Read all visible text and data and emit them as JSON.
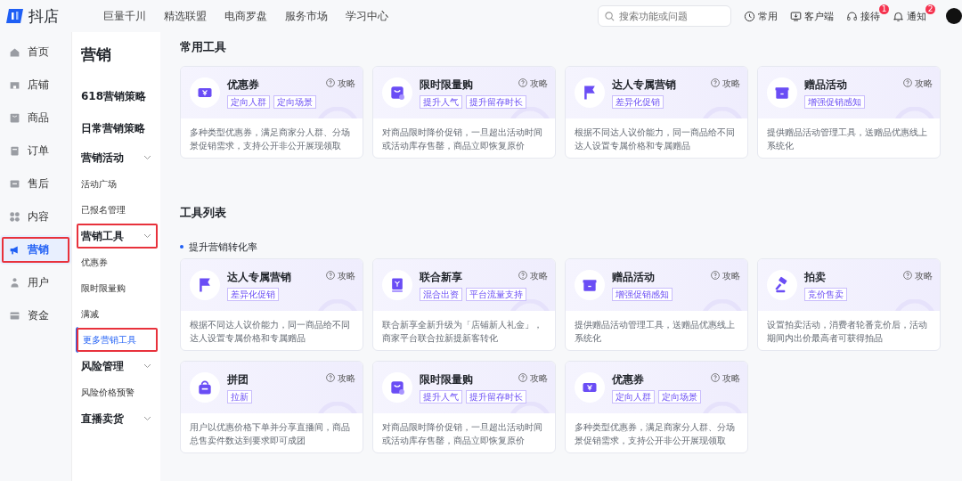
{
  "topbar": {
    "logo": "抖店",
    "nav": [
      "巨量千川",
      "精选联盟",
      "电商罗盘",
      "服务市场",
      "学习中心"
    ],
    "search": {
      "placeholder": "搜索功能或问题"
    },
    "actions": [
      {
        "kind": "clock",
        "label": "常用"
      },
      {
        "kind": "monitor",
        "label": "客户端"
      },
      {
        "kind": "headset",
        "label": "接待",
        "badge": "1"
      },
      {
        "kind": "bell",
        "label": "通知",
        "badge": "2"
      }
    ]
  },
  "nav": [
    {
      "label": "首页",
      "selected": false,
      "highlighted": false
    },
    {
      "label": "店铺",
      "selected": false,
      "highlighted": false
    },
    {
      "label": "商品",
      "selected": false,
      "highlighted": false
    },
    {
      "label": "订单",
      "selected": false,
      "highlighted": false
    },
    {
      "label": "售后",
      "selected": false,
      "highlighted": false
    },
    {
      "label": "内容",
      "selected": false,
      "highlighted": false
    },
    {
      "label": "营销",
      "selected": true,
      "highlighted": true
    },
    {
      "label": "用户",
      "selected": false,
      "highlighted": false
    },
    {
      "label": "资金",
      "selected": false,
      "highlighted": false
    }
  ],
  "subnav": {
    "title": "营销",
    "items": [
      {
        "kind": "heading",
        "label": "618营销策略",
        "selected": false,
        "highlighted": false
      },
      {
        "kind": "heading",
        "label": "日常营销策略",
        "selected": false,
        "highlighted": false
      },
      {
        "kind": "group",
        "label": "营销活动",
        "selected": false,
        "highlighted": false
      },
      {
        "kind": "link",
        "label": "活动广场",
        "selected": false,
        "highlighted": false
      },
      {
        "kind": "link",
        "label": "已报名管理",
        "selected": false,
        "highlighted": false
      },
      {
        "kind": "group",
        "label": "营销工具",
        "selected": false,
        "highlighted": true
      },
      {
        "kind": "link",
        "label": "优惠券",
        "selected": false,
        "highlighted": false
      },
      {
        "kind": "link",
        "label": "限时限量购",
        "selected": false,
        "highlighted": false
      },
      {
        "kind": "link",
        "label": "满减",
        "selected": false,
        "highlighted": false
      },
      {
        "kind": "link",
        "label": "更多营销工具",
        "selected": true,
        "highlighted": true
      },
      {
        "kind": "group",
        "label": "风险管理",
        "selected": false,
        "highlighted": false
      },
      {
        "kind": "link",
        "label": "风险价格预警",
        "selected": false,
        "highlighted": false
      },
      {
        "kind": "group",
        "label": "直播卖货",
        "selected": false,
        "highlighted": false
      }
    ]
  },
  "common_tools": {
    "title": "常用工具",
    "cards": [
      {
        "kind": "coupon",
        "title": "优惠券",
        "guide": "攻略",
        "tags": [
          "定向人群",
          "定向场景"
        ],
        "description": "多种类型优惠券，满足商家分人群、分场景促销需求，支持公开非公开展现领取"
      },
      {
        "kind": "flash-sale",
        "title": "限时限量购",
        "guide": "攻略",
        "tags": [
          "提升人气",
          "提升留存时长"
        ],
        "description": "对商品限时降价促销，一旦超出活动时间或活动库存售罄，商品立即恢复原价"
      },
      {
        "kind": "influencer",
        "title": "达人专属营销",
        "guide": "攻略",
        "tags": [
          "差异化促销"
        ],
        "description": "根据不同达人议价能力，同一商品给不同达人设置专属价格和专属赠品"
      },
      {
        "kind": "gift",
        "title": "赠品活动",
        "guide": "攻略",
        "tags": [
          "增强促销感知"
        ],
        "description": "提供赠品活动管理工具，送赠品优惠线上系统化"
      }
    ]
  },
  "tool_list": {
    "title": "工具列表",
    "section": "提升营销转化率",
    "cards": [
      {
        "kind": "influencer",
        "title": "达人专属营销",
        "guide": "攻略",
        "tags": [
          "差异化促销"
        ],
        "description": "根据不同达人议价能力，同一商品给不同达人设置专属价格和专属赠品"
      },
      {
        "kind": "newcomer",
        "title": "联合新享",
        "guide": "攻略",
        "tags": [
          "混合出资",
          "平台流量支持"
        ],
        "description": "联合新享全新升级为「店铺新人礼金」，商家平台联合拉新提新客转化"
      },
      {
        "kind": "gift",
        "title": "赠品活动",
        "guide": "攻略",
        "tags": [
          "增强促销感知"
        ],
        "description": "提供赠品活动管理工具，送赠品优惠线上系统化"
      },
      {
        "kind": "auction",
        "title": "拍卖",
        "guide": "攻略",
        "tags": [
          "竞价售卖"
        ],
        "description": "设置拍卖活动，消费者轮番竞价后，活动期间内出价最高者可获得拍品"
      },
      {
        "kind": "group-buy",
        "title": "拼团",
        "guide": "攻略",
        "tags": [
          "拉新"
        ],
        "description": "用户以优惠价格下单并分享直播间，商品总售卖件数达到要求即可成团"
      },
      {
        "kind": "flash-sale",
        "title": "限时限量购",
        "guide": "攻略",
        "tags": [
          "提升人气",
          "提升留存时长"
        ],
        "description": "对商品限时降价促销，一旦超出活动时间或活动库存售罄，商品立即恢复原价"
      },
      {
        "kind": "coupon",
        "title": "优惠券",
        "guide": "攻略",
        "tags": [
          "定向人群",
          "定向场景"
        ],
        "description": "多种类型优惠券，满足商家分人群、分场景促销需求，支持公开非公开展现领取"
      }
    ]
  }
}
